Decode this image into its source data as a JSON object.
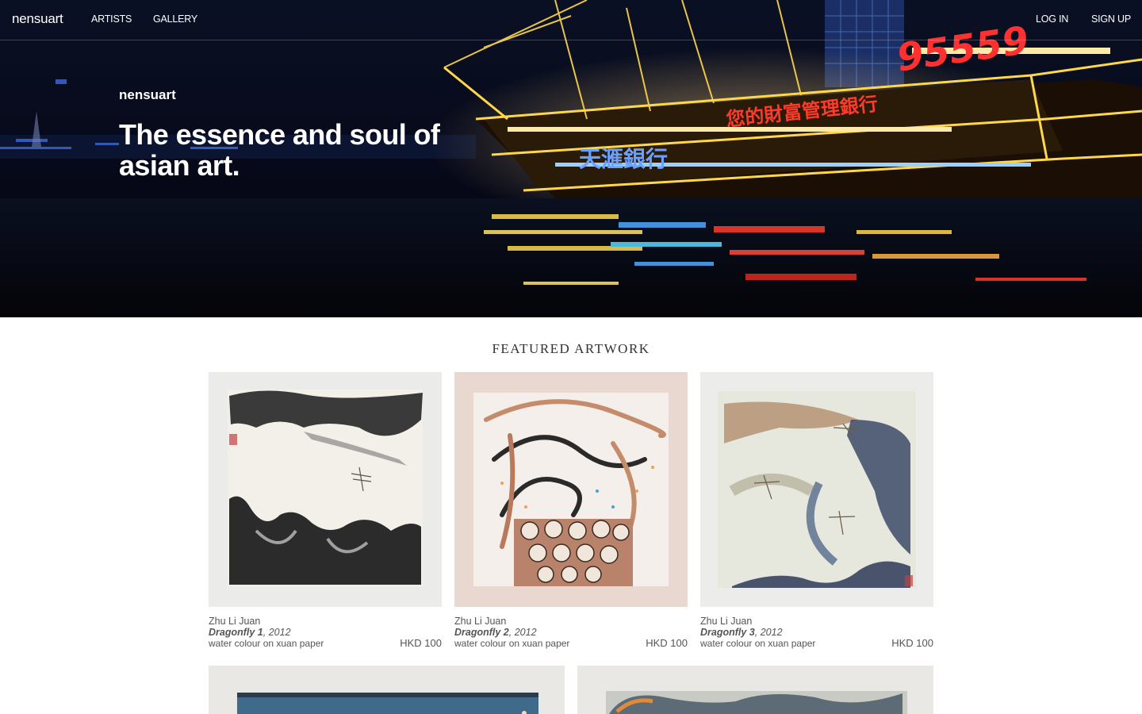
{
  "nav": {
    "brand": "nensuart",
    "artists": "ARTISTS",
    "gallery": "GALLERY",
    "login": "LOG IN",
    "signup": "SIGN UP"
  },
  "hero": {
    "brand": "nensuart",
    "tagline": "The essence and soul of asian art.",
    "sign_number": "95559",
    "sign_text_1": "您的財富管理銀行",
    "sign_text_2": "天滙銀行"
  },
  "featured": {
    "title": "FEATURED ARTWORK",
    "artworks": [
      {
        "artist": "Zhu Li Juan",
        "title": "Dragonfly 1",
        "year": ", 2012",
        "medium": "water colour on xuan paper",
        "price": "HKD 100"
      },
      {
        "artist": "Zhu Li Juan",
        "title": "Dragonfly 2",
        "year": ", 2012",
        "medium": "water colour on xuan paper",
        "price": "HKD 100"
      },
      {
        "artist": "Zhu Li Juan",
        "title": "Dragonfly 3",
        "year": ", 2012",
        "medium": "water colour on xuan paper",
        "price": "HKD 100"
      }
    ]
  }
}
